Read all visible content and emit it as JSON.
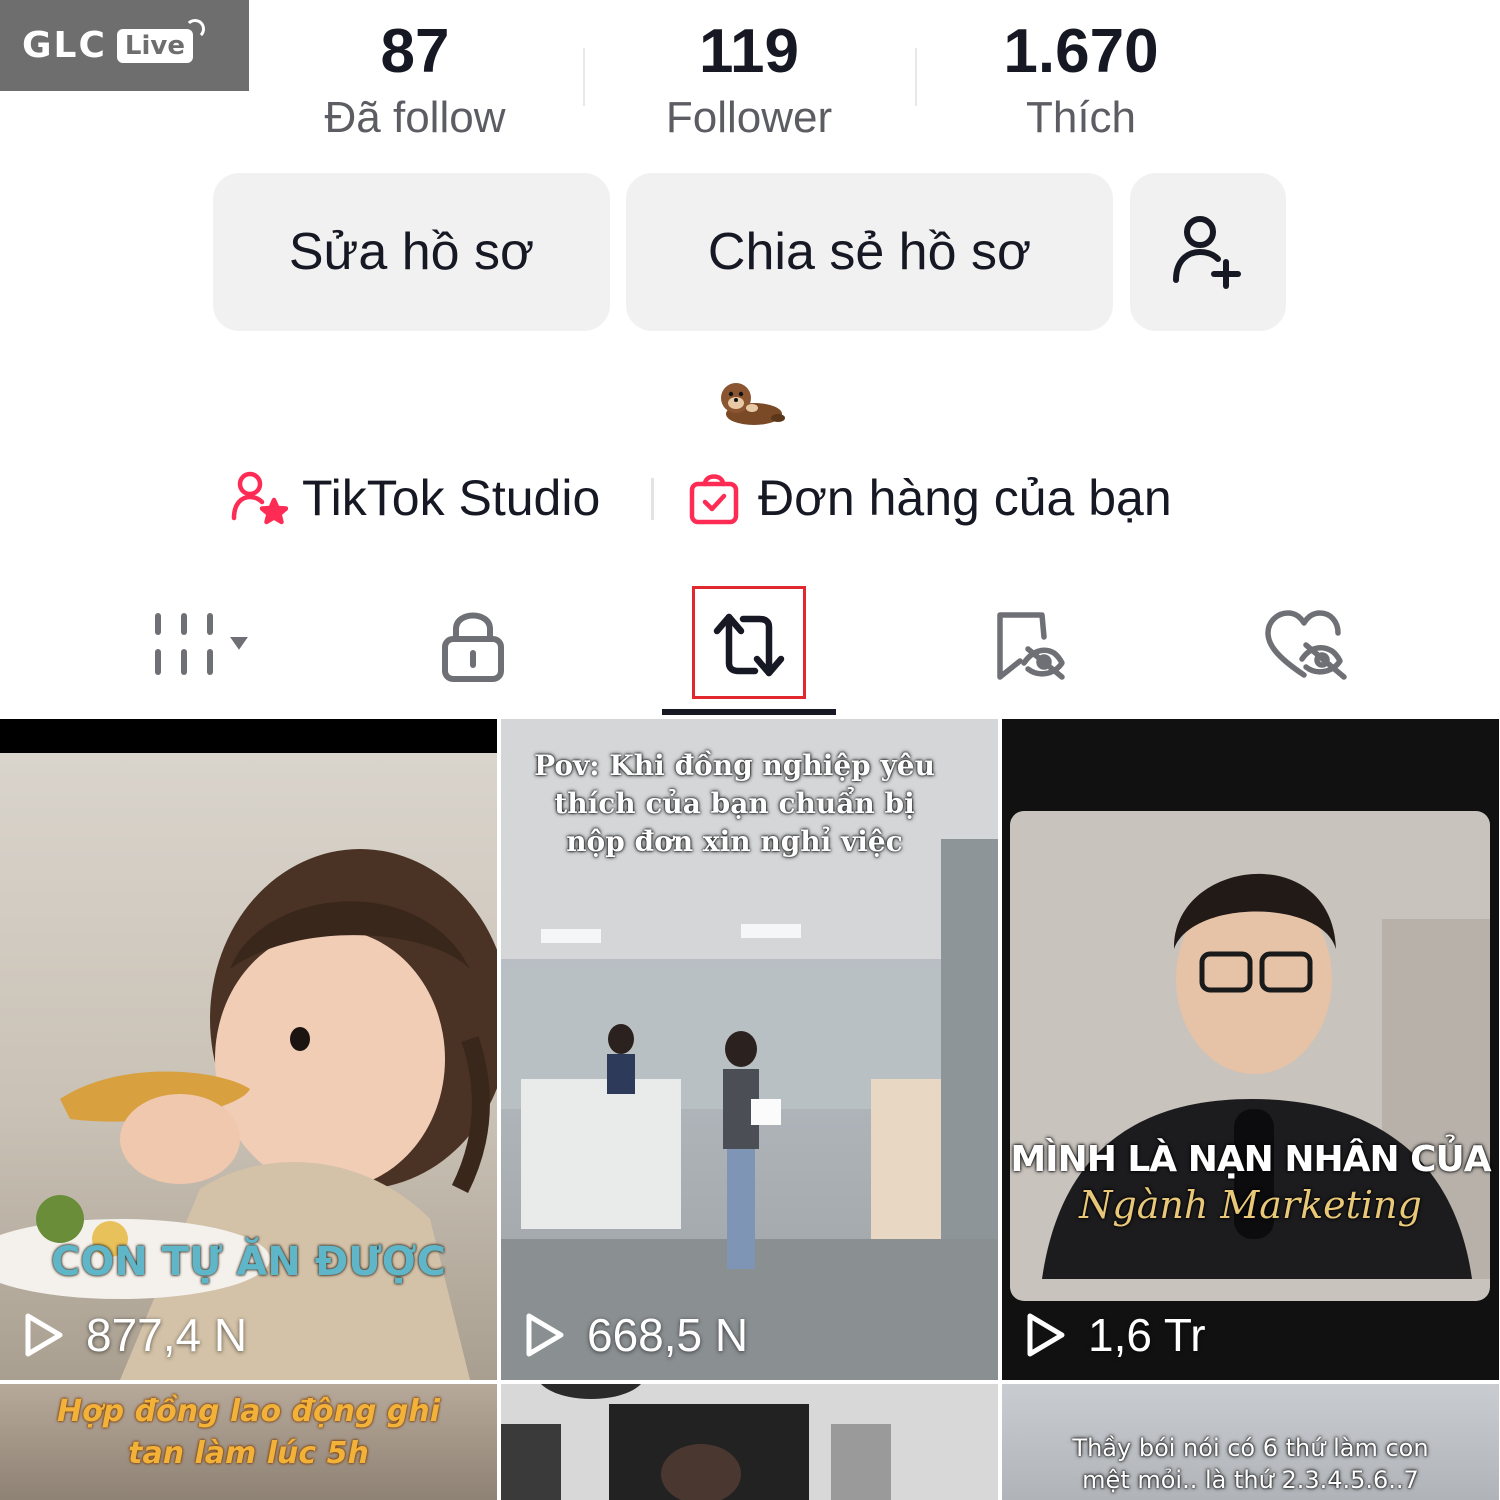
{
  "watermark": {
    "brand": "GLC",
    "badge": "Live"
  },
  "stats": [
    {
      "value": "87",
      "label": "Đã follow"
    },
    {
      "value": "119",
      "label": "Follower"
    },
    {
      "value": "1.670",
      "label": "Thích"
    }
  ],
  "buttons": {
    "edit_profile": "Sửa hồ sơ",
    "share_profile": "Chia sẻ hồ sơ"
  },
  "links": {
    "studio": "TikTok Studio",
    "orders": "Đơn hàng của bạn"
  },
  "tabs": [
    {
      "icon": "grid-dropdown-icon"
    },
    {
      "icon": "lock-icon"
    },
    {
      "icon": "repost-icon",
      "active": true
    },
    {
      "icon": "bookmark-hidden-icon"
    },
    {
      "icon": "heart-hidden-icon"
    }
  ],
  "videos": [
    {
      "views": "877,4 N",
      "caption": "CON TỰ ĂN ĐƯỢC"
    },
    {
      "views": "668,5 N",
      "caption": "Pov: Khi đồng nghiệp yêu thích của bạn chuẩn bị nộp đơn xin nghỉ việc"
    },
    {
      "views": "1,6 Tr",
      "caption_line1": "MÌNH LÀ NẠN NHÂN CỦA",
      "caption_line2": "Ngành Marketing"
    },
    {
      "caption_line1": "Hợp đồng lao động ghi",
      "caption_line2": "tan làm lúc 5h"
    },
    {},
    {
      "caption_line1": "Thầy bói nói có 6 thứ làm con",
      "caption_line2": "mệt mỏi.. là thứ 2.3.4.5.6..7"
    }
  ],
  "colors": {
    "accent": "#fe2c55",
    "active_outline": "#e0282e",
    "button_bg": "#f1f1f2"
  }
}
